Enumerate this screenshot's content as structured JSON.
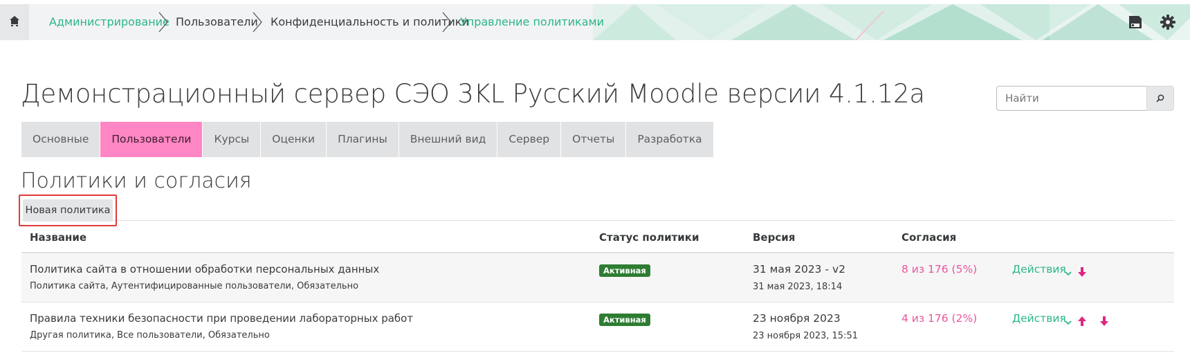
{
  "breadcrumb": {
    "items": [
      {
        "label": "Администрирование"
      },
      {
        "label": "Пользователи"
      },
      {
        "label": "Конфиденциальность и политики"
      },
      {
        "label": "Управление политиками"
      }
    ]
  },
  "header": {
    "site_title": "Демонстрационный сервер СЭО 3KL Русский Moodle версии 4.1.12а",
    "search_placeholder": "Найти"
  },
  "tabs": [
    {
      "label": "Основные"
    },
    {
      "label": "Пользователи"
    },
    {
      "label": "Курсы"
    },
    {
      "label": "Оценки"
    },
    {
      "label": "Плагины"
    },
    {
      "label": "Внешний вид"
    },
    {
      "label": "Сервер"
    },
    {
      "label": "Отчеты"
    },
    {
      "label": "Разработка"
    }
  ],
  "section": {
    "title": "Политики и согласия",
    "new_policy_label": "Новая политика"
  },
  "table": {
    "headers": {
      "name": "Название",
      "status": "Статус политики",
      "version": "Версия",
      "consents": "Согласия"
    },
    "rows": [
      {
        "name": "Политика сайта в отношении обработки персональных данных",
        "details": "Политика сайта, Аутентифицированные пользователи, Обязательно",
        "status": "Активная",
        "version": "31 мая 2023 - v2",
        "version_date": "31 мая 2023, 18:14",
        "consents": "8 из 176 (5%)",
        "actions": "Действия"
      },
      {
        "name": "Правила техники безопасности при проведении лабораторных работ",
        "details": "Другая политика, Все пользователи, Обязательно",
        "status": "Активная",
        "version": "23 ноября 2023",
        "version_date": "23 ноября 2023, 15:51",
        "consents": "4 из 176 (2%)",
        "actions": "Действия"
      }
    ]
  },
  "colors": {
    "accent_green": "#2bb58a",
    "active_tab": "#ff86c4",
    "consent_pink": "#e8559e",
    "badge_green": "#2e7d32",
    "arrow_pink": "#e0267f"
  },
  "icons": {
    "home": "home-icon",
    "save": "save-icon",
    "settings": "gear-icon",
    "search": "search-icon",
    "chevron": "chevron-down-icon",
    "move_up": "arrow-up-icon",
    "move_down": "arrow-down-icon"
  }
}
